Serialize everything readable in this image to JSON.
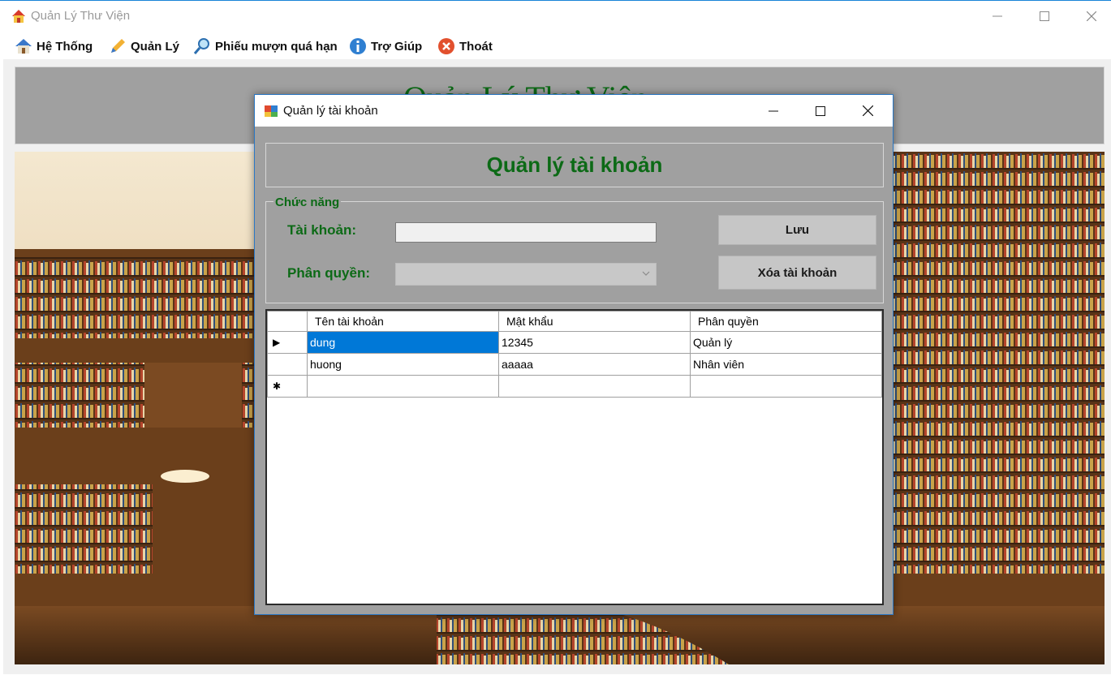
{
  "main_window": {
    "title": "Quản Lý Thư Viện",
    "menu": [
      {
        "label": "Hệ Thống",
        "icon": "home-icon"
      },
      {
        "label": "Quản Lý",
        "icon": "pencil-icon"
      },
      {
        "label": "Phiếu mượn quá hạn",
        "icon": "magnifier-icon"
      },
      {
        "label": "Trợ Giúp",
        "icon": "info-icon"
      },
      {
        "label": "Thoát",
        "icon": "close-circle-icon"
      }
    ],
    "banner_title": "Quản Lý Thư Viện"
  },
  "dialog": {
    "title": "Quản lý tài khoản",
    "header": "Quản lý tài khoản",
    "group_label": "Chức năng",
    "account_label": "Tài khoản:",
    "account_value": "",
    "role_label": "Phân quyền:",
    "role_value": "",
    "save_button": "Lưu",
    "delete_button": "Xóa tài khoản",
    "grid": {
      "columns": [
        "Tên tài khoản",
        "Mật khẩu",
        "Phân quyền"
      ],
      "rows": [
        {
          "marker": "▶",
          "cells": [
            "dung",
            "12345",
            "Quản lý"
          ]
        },
        {
          "marker": "",
          "cells": [
            "huong",
            "aaaaa",
            "Nhân viên"
          ]
        },
        {
          "marker": "✱",
          "cells": [
            "",
            "",
            ""
          ]
        }
      ]
    }
  },
  "colors": {
    "title_green": "#0c6a16",
    "selection_blue": "#0078d7",
    "panel_gray": "#a0a0a0"
  }
}
